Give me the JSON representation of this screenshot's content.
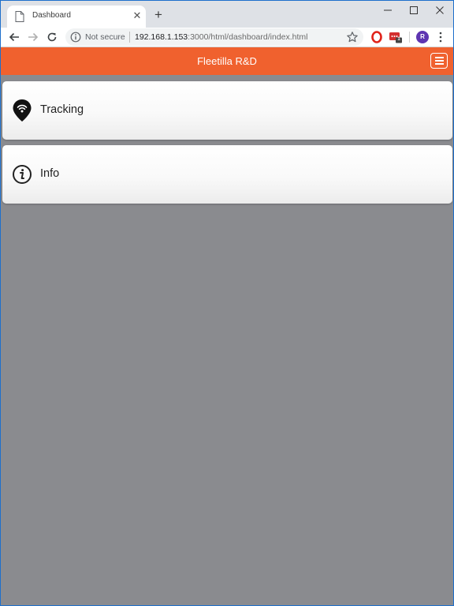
{
  "browser": {
    "tab": {
      "title": "Dashboard"
    },
    "address_bar": {
      "security_label": "Not secure",
      "url_host": "192.168.1.153",
      "url_rest": ":3000/html/dashboard/index.html"
    },
    "extensions": {
      "badge_count": "1"
    },
    "profile": {
      "initial": "R",
      "color": "#5e35b1"
    }
  },
  "app": {
    "title": "Fleetilla R&D",
    "header_color": "#f0612e",
    "cards": [
      {
        "label": "Tracking",
        "icon": "map-pin-wifi-icon"
      },
      {
        "label": "Info",
        "icon": "info-circle-icon"
      }
    ]
  }
}
